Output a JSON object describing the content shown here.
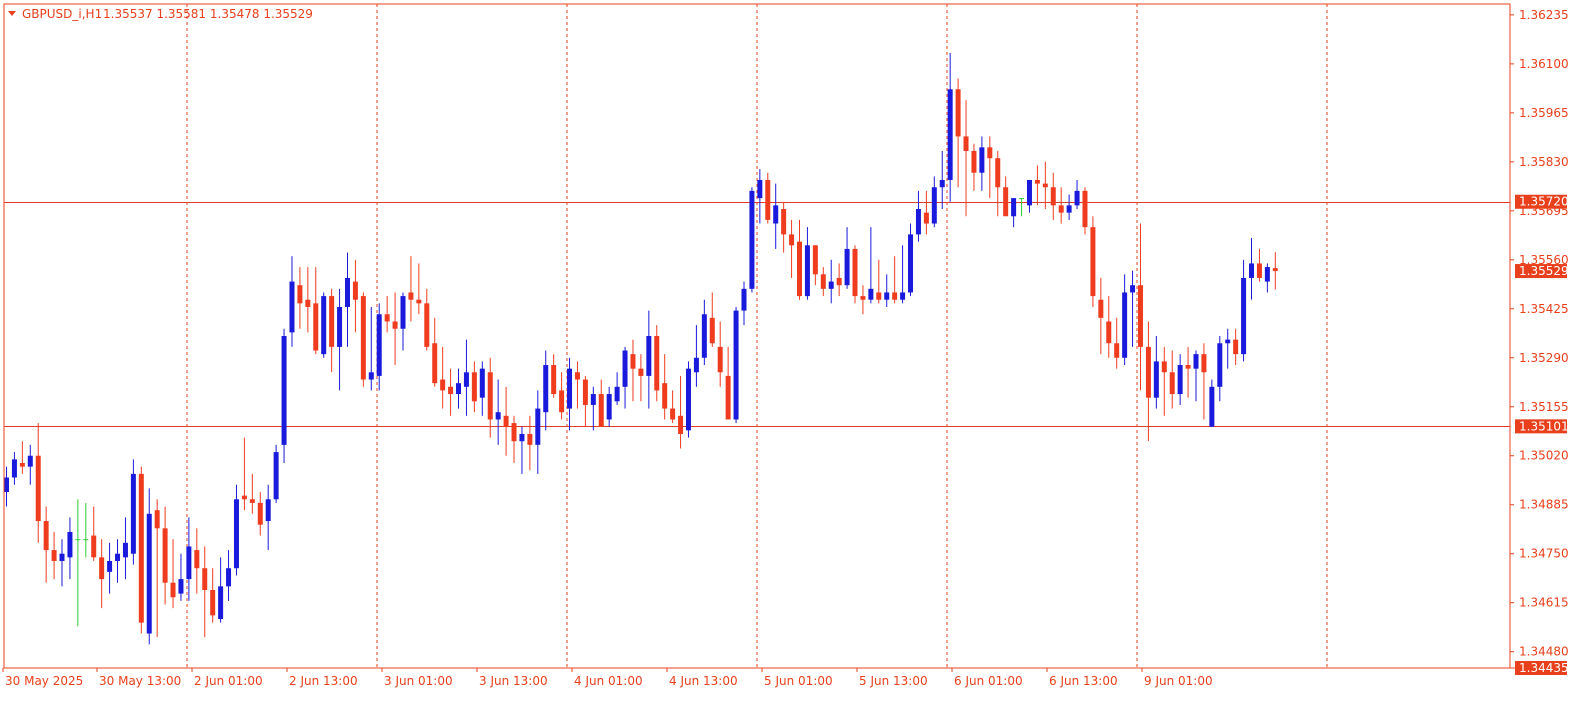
{
  "header": {
    "symbol": "GBPUSD_i,H1",
    "prices": "1.35537 1.35581 1.35478 1.35529"
  },
  "colors": {
    "frame": "#e8401c",
    "grid": "#e8401c",
    "bull": "#1a1adc",
    "bear": "#f03c1e",
    "doji": "#33cc33",
    "hline": "#e03c28",
    "tag_fill": "#e8401c",
    "current_tag_fill": "#e8401c",
    "tag_text": "#ffffff"
  },
  "chart_data": {
    "type": "candlestick",
    "symbol": "GBPUSD_i",
    "timeframe": "H1",
    "title": "GBPUSD_i,H1",
    "ohlc_last": {
      "open": 1.35537,
      "high": 1.35581,
      "low": 1.35478,
      "close": 1.35529
    },
    "ylim": [
      1.34435,
      1.36265
    ],
    "y_ticks": [
      "1.36235",
      "1.36100",
      "1.35965",
      "1.35830",
      "1.35695",
      "1.35560",
      "1.35425",
      "1.35290",
      "1.35155",
      "1.35020",
      "1.34885",
      "1.34750",
      "1.34615",
      "1.34480"
    ],
    "x_ticks": [
      "30 May 2025",
      "30 May 13:00",
      "2 Jun 01:00",
      "2 Jun 13:00",
      "3 Jun 01:00",
      "3 Jun 13:00",
      "4 Jun 01:00",
      "4 Jun 13:00",
      "5 Jun 01:00",
      "5 Jun 13:00",
      "6 Jun 01:00",
      "6 Jun 13:00",
      "9 Jun 01:00"
    ],
    "horizontal_lines": [
      {
        "label": "1.35720",
        "value": 1.3572
      },
      {
        "label": "1.35101",
        "value": 1.35101
      }
    ],
    "current_price": {
      "label": "1.35529",
      "value": 1.35529
    },
    "bottom_price": {
      "label": "1.34435",
      "value": 1.34435
    },
    "candles": [
      [
        1.3492,
        1.3499,
        1.3488,
        1.3496
      ],
      [
        1.3496,
        1.3503,
        1.3494,
        1.3501
      ],
      [
        1.35,
        1.3506,
        1.3497,
        1.3499
      ],
      [
        1.3499,
        1.3505,
        1.3494,
        1.3502
      ],
      [
        1.3502,
        1.3511,
        1.3478,
        1.3484
      ],
      [
        1.3484,
        1.3488,
        1.3467,
        1.3476
      ],
      [
        1.3476,
        1.3481,
        1.3468,
        1.3473
      ],
      [
        1.3473,
        1.3479,
        1.3466,
        1.3475
      ],
      [
        1.3474,
        1.3485,
        1.3468,
        1.3481
      ],
      [
        1.3479,
        1.349,
        1.3455,
        1.3479
      ],
      [
        1.3479,
        1.3489,
        1.3474,
        1.3479
      ],
      [
        1.348,
        1.3488,
        1.3473,
        1.3474
      ],
      [
        1.3474,
        1.3479,
        1.346,
        1.3468
      ],
      [
        1.347,
        1.3478,
        1.3464,
        1.3473
      ],
      [
        1.3473,
        1.3479,
        1.3467,
        1.3475
      ],
      [
        1.3474,
        1.3485,
        1.3468,
        1.3478
      ],
      [
        1.3475,
        1.3501,
        1.3472,
        1.3497
      ],
      [
        1.3497,
        1.3499,
        1.3453,
        1.3456
      ],
      [
        1.3453,
        1.3493,
        1.345,
        1.3486
      ],
      [
        1.3487,
        1.349,
        1.3452,
        1.3482
      ],
      [
        1.3482,
        1.3488,
        1.3461,
        1.3467
      ],
      [
        1.3467,
        1.3479,
        1.346,
        1.3463
      ],
      [
        1.3464,
        1.3475,
        1.3462,
        1.3468
      ],
      [
        1.3468,
        1.3485,
        1.3462,
        1.3477
      ],
      [
        1.3476,
        1.3482,
        1.3464,
        1.3471
      ],
      [
        1.3471,
        1.3477,
        1.3452,
        1.3465
      ],
      [
        1.3465,
        1.3471,
        1.3456,
        1.3458
      ],
      [
        1.3457,
        1.3474,
        1.3456,
        1.3466
      ],
      [
        1.3466,
        1.3476,
        1.3462,
        1.3471
      ],
      [
        1.3471,
        1.3494,
        1.3469,
        1.349
      ],
      [
        1.3491,
        1.3507,
        1.3487,
        1.349
      ],
      [
        1.349,
        1.3497,
        1.3486,
        1.3489
      ],
      [
        1.3489,
        1.3492,
        1.348,
        1.3483
      ],
      [
        1.3484,
        1.3494,
        1.3476,
        1.349
      ],
      [
        1.349,
        1.3505,
        1.3489,
        1.3503
      ],
      [
        1.3505,
        1.3537,
        1.35,
        1.3535
      ],
      [
        1.3536,
        1.3557,
        1.3532,
        1.355
      ],
      [
        1.3549,
        1.3554,
        1.3537,
        1.3544
      ],
      [
        1.3545,
        1.3554,
        1.3536,
        1.3543
      ],
      [
        1.3544,
        1.3554,
        1.353,
        1.3531
      ],
      [
        1.353,
        1.3547,
        1.3529,
        1.3546
      ],
      [
        1.3546,
        1.3548,
        1.3525,
        1.3532
      ],
      [
        1.3532,
        1.3548,
        1.352,
        1.3543
      ],
      [
        1.3543,
        1.3558,
        1.3532,
        1.3551
      ],
      [
        1.355,
        1.3556,
        1.3536,
        1.3545
      ],
      [
        1.3546,
        1.3547,
        1.3521,
        1.3523
      ],
      [
        1.3523,
        1.3543,
        1.352,
        1.3525
      ],
      [
        1.3524,
        1.3544,
        1.352,
        1.3541
      ],
      [
        1.3541,
        1.3546,
        1.3536,
        1.3539
      ],
      [
        1.3539,
        1.3547,
        1.3527,
        1.3537
      ],
      [
        1.3537,
        1.3547,
        1.3531,
        1.3546
      ],
      [
        1.3547,
        1.3557,
        1.3539,
        1.3545
      ],
      [
        1.3545,
        1.3555,
        1.3541,
        1.3544
      ],
      [
        1.3544,
        1.3548,
        1.3531,
        1.3532
      ],
      [
        1.3533,
        1.354,
        1.3521,
        1.3522
      ],
      [
        1.3523,
        1.3532,
        1.3515,
        1.352
      ],
      [
        1.3521,
        1.3526,
        1.3513,
        1.3519
      ],
      [
        1.3519,
        1.3526,
        1.3515,
        1.3522
      ],
      [
        1.3521,
        1.3534,
        1.3513,
        1.3525
      ],
      [
        1.3525,
        1.3528,
        1.3514,
        1.3517
      ],
      [
        1.3518,
        1.3528,
        1.3513,
        1.3526
      ],
      [
        1.3525,
        1.3529,
        1.3507,
        1.3512
      ],
      [
        1.3512,
        1.3523,
        1.3505,
        1.3514
      ],
      [
        1.3513,
        1.3521,
        1.3502,
        1.351
      ],
      [
        1.3511,
        1.3513,
        1.35,
        1.3506
      ],
      [
        1.3506,
        1.351,
        1.3497,
        1.3508
      ],
      [
        1.3508,
        1.3513,
        1.3498,
        1.3505
      ],
      [
        1.3505,
        1.352,
        1.3497,
        1.3515
      ],
      [
        1.3514,
        1.3531,
        1.3509,
        1.3527
      ],
      [
        1.3527,
        1.353,
        1.3518,
        1.3519
      ],
      [
        1.352,
        1.3525,
        1.3512,
        1.3514
      ],
      [
        1.3515,
        1.3529,
        1.3509,
        1.3526
      ],
      [
        1.3525,
        1.3528,
        1.3515,
        1.3523
      ],
      [
        1.3523,
        1.3524,
        1.351,
        1.3516
      ],
      [
        1.3516,
        1.3521,
        1.3509,
        1.3519
      ],
      [
        1.3519,
        1.3523,
        1.351,
        1.351
      ],
      [
        1.3512,
        1.3521,
        1.351,
        1.3519
      ],
      [
        1.3517,
        1.3525,
        1.3516,
        1.3521
      ],
      [
        1.3521,
        1.3532,
        1.3515,
        1.3531
      ],
      [
        1.353,
        1.3534,
        1.3517,
        1.3526
      ],
      [
        1.3526,
        1.353,
        1.3517,
        1.3524
      ],
      [
        1.3524,
        1.3542,
        1.3515,
        1.3535
      ],
      [
        1.3535,
        1.3538,
        1.3517,
        1.352
      ],
      [
        1.3522,
        1.353,
        1.3512,
        1.3515
      ],
      [
        1.3515,
        1.352,
        1.3511,
        1.3512
      ],
      [
        1.3513,
        1.3524,
        1.3504,
        1.3508
      ],
      [
        1.3509,
        1.3528,
        1.3507,
        1.3526
      ],
      [
        1.3525,
        1.3538,
        1.3521,
        1.3529
      ],
      [
        1.3529,
        1.3545,
        1.3527,
        1.3541
      ],
      [
        1.354,
        1.3547,
        1.3532,
        1.3533
      ],
      [
        1.3532,
        1.3539,
        1.3521,
        1.3525
      ],
      [
        1.3524,
        1.3532,
        1.3514,
        1.3512
      ],
      [
        1.3512,
        1.3543,
        1.3511,
        1.3542
      ],
      [
        1.3542,
        1.355,
        1.3538,
        1.3548
      ],
      [
        1.3548,
        1.3576,
        1.3547,
        1.3575
      ],
      [
        1.3573,
        1.3581,
        1.3566,
        1.3578
      ],
      [
        1.3578,
        1.358,
        1.3566,
        1.3567
      ],
      [
        1.3566,
        1.3577,
        1.3559,
        1.3571
      ],
      [
        1.357,
        1.3572,
        1.3558,
        1.3563
      ],
      [
        1.3563,
        1.3567,
        1.3551,
        1.356
      ],
      [
        1.3561,
        1.3567,
        1.3545,
        1.3546
      ],
      [
        1.3546,
        1.3565,
        1.3545,
        1.356
      ],
      [
        1.356,
        1.356,
        1.3549,
        1.3552
      ],
      [
        1.3552,
        1.3554,
        1.3546,
        1.3548
      ],
      [
        1.3548,
        1.3556,
        1.3544,
        1.355
      ],
      [
        1.3551,
        1.3555,
        1.3546,
        1.3549
      ],
      [
        1.3549,
        1.3565,
        1.3548,
        1.3559
      ],
      [
        1.3559,
        1.356,
        1.3544,
        1.3546
      ],
      [
        1.3546,
        1.3549,
        1.3541,
        1.3545
      ],
      [
        1.3545,
        1.3565,
        1.3544,
        1.3548
      ],
      [
        1.3547,
        1.3556,
        1.3544,
        1.3545
      ],
      [
        1.3545,
        1.3552,
        1.3543,
        1.3547
      ],
      [
        1.3547,
        1.3557,
        1.3544,
        1.3545
      ],
      [
        1.3545,
        1.356,
        1.3544,
        1.3547
      ],
      [
        1.3547,
        1.3566,
        1.3546,
        1.3563
      ],
      [
        1.3563,
        1.3575,
        1.3561,
        1.357
      ],
      [
        1.3569,
        1.3575,
        1.3563,
        1.3566
      ],
      [
        1.3566,
        1.3579,
        1.3565,
        1.3576
      ],
      [
        1.3576,
        1.3586,
        1.357,
        1.3578
      ],
      [
        1.3578,
        1.3613,
        1.3572,
        1.3603
      ],
      [
        1.3603,
        1.3606,
        1.3576,
        1.359
      ],
      [
        1.359,
        1.36,
        1.3568,
        1.3586
      ],
      [
        1.3586,
        1.3588,
        1.3575,
        1.358
      ],
      [
        1.358,
        1.359,
        1.3575,
        1.3587
      ],
      [
        1.3587,
        1.359,
        1.3573,
        1.3584
      ],
      [
        1.3584,
        1.3586,
        1.3568,
        1.3576
      ],
      [
        1.3576,
        1.3579,
        1.357,
        1.3568
      ],
      [
        1.3568,
        1.3573,
        1.3565,
        1.3573
      ],
      [
        1.3573,
        1.3573,
        1.3568,
        1.3573
      ],
      [
        1.3571,
        1.3578,
        1.3569,
        1.3578
      ],
      [
        1.3578,
        1.3582,
        1.3571,
        1.3577
      ],
      [
        1.3577,
        1.3583,
        1.357,
        1.3576
      ],
      [
        1.3576,
        1.358,
        1.3567,
        1.3571
      ],
      [
        1.3571,
        1.3576,
        1.3566,
        1.3569
      ],
      [
        1.3569,
        1.3574,
        1.3567,
        1.3571
      ],
      [
        1.3571,
        1.3578,
        1.357,
        1.3575
      ],
      [
        1.3575,
        1.3576,
        1.3563,
        1.3565
      ],
      [
        1.3565,
        1.3568,
        1.3543,
        1.3546
      ],
      [
        1.3545,
        1.3551,
        1.353,
        1.354
      ],
      [
        1.3539,
        1.3546,
        1.3529,
        1.3533
      ],
      [
        1.3533,
        1.354,
        1.3526,
        1.3529
      ],
      [
        1.3529,
        1.3552,
        1.3527,
        1.3547
      ],
      [
        1.3547,
        1.3553,
        1.3532,
        1.3549
      ],
      [
        1.3549,
        1.3566,
        1.352,
        1.3532
      ],
      [
        1.3532,
        1.3539,
        1.3506,
        1.3518
      ],
      [
        1.3518,
        1.3535,
        1.3515,
        1.3528
      ],
      [
        1.3528,
        1.3532,
        1.3513,
        1.3525
      ],
      [
        1.3525,
        1.3531,
        1.3515,
        1.3519
      ],
      [
        1.3519,
        1.353,
        1.3516,
        1.3527
      ],
      [
        1.3527,
        1.3532,
        1.3518,
        1.3526
      ],
      [
        1.3526,
        1.3531,
        1.3517,
        1.353
      ],
      [
        1.353,
        1.3533,
        1.3512,
        1.3525
      ],
      [
        1.351,
        1.3523,
        1.351,
        1.3521
      ],
      [
        1.3521,
        1.3535,
        1.3517,
        1.3533
      ],
      [
        1.3533,
        1.3537,
        1.3526,
        1.3534
      ],
      [
        1.3534,
        1.3537,
        1.3527,
        1.353
      ],
      [
        1.353,
        1.3556,
        1.3528,
        1.3551
      ],
      [
        1.3551,
        1.3562,
        1.3545,
        1.3555
      ],
      [
        1.3555,
        1.3559,
        1.355,
        1.3551
      ],
      [
        1.355,
        1.3555,
        1.3547,
        1.3554
      ],
      [
        1.35537,
        1.35581,
        1.35478,
        1.35529
      ]
    ]
  }
}
